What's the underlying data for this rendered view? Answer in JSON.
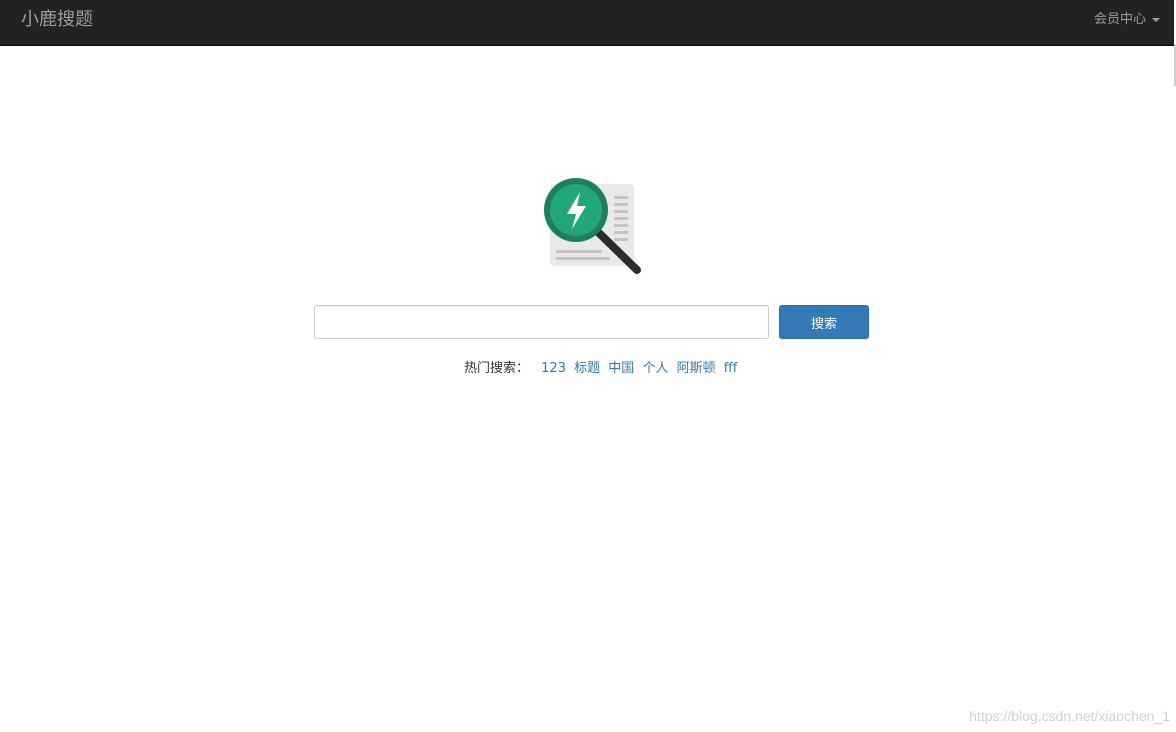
{
  "navbar": {
    "brand": "小鹿搜题",
    "member_center": "会员中心"
  },
  "search": {
    "placeholder": "",
    "value": "",
    "button_label": "搜索"
  },
  "hot_search": {
    "label": "热门搜索：",
    "links": [
      "123",
      "标题",
      "中国",
      "个人",
      "阿斯顿",
      "fff"
    ]
  },
  "watermark": "https://blog.csdn.net/xiaochen_1",
  "colors": {
    "navbar_bg": "#222222",
    "primary": "#337ab7",
    "logo_green": "#1fa67a"
  }
}
